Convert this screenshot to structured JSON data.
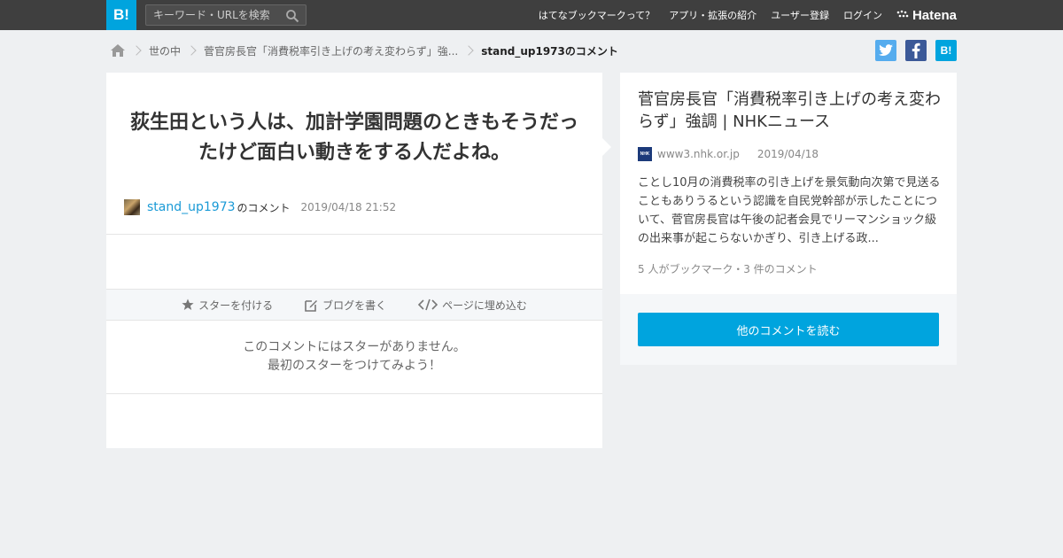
{
  "header": {
    "logo": "B!",
    "search_placeholder": "キーワード・URLを検索",
    "nav": [
      "はてなブックマークって？",
      "アプリ・拡張の紹介",
      "ユーザー登録",
      "ログイン"
    ],
    "brand": "Hatena"
  },
  "breadcrumb": {
    "items": [
      "世の中",
      "菅官房長官「消費税率引き上げの考え変わらず」強..."
    ],
    "current": "stand_up1973のコメント"
  },
  "social": {
    "hatena_label": "B!"
  },
  "comment": {
    "text": "荻生田という人は、加計学園問題のときもそうだったけど面白い動きをする人だよね。",
    "user": "stand_up1973",
    "suffix": "のコメント",
    "datetime": "2019/04/18 21:52"
  },
  "actions": {
    "star": "スターを付ける",
    "blog": "ブログを書く",
    "embed": "ページに埋め込む"
  },
  "no_star": {
    "line1": "このコメントにはスターがありません。",
    "line2": "最初のスターをつけてみよう！"
  },
  "article": {
    "title": "菅官房長官「消費税率引き上げの考え変わらず」強調 | NHKニュース",
    "favicon_text": "NHK",
    "domain": "www3.nhk.or.jp",
    "date": "2019/04/18",
    "excerpt": "ことし10月の消費税率の引き上げを景気動向次第で見送ることもありうるという認識を自民党幹部が示したことについて、菅官房長官は午後の記者会見でリーマンショック級の出来事が起こらないかぎり、引き上げる政...",
    "counts": "5 人がブックマーク・3 件のコメント",
    "read_button": "他のコメントを読む"
  },
  "colors": {
    "accent": "#00a4de",
    "topbar": "#3f3f3f",
    "background": "#eef0f2"
  }
}
